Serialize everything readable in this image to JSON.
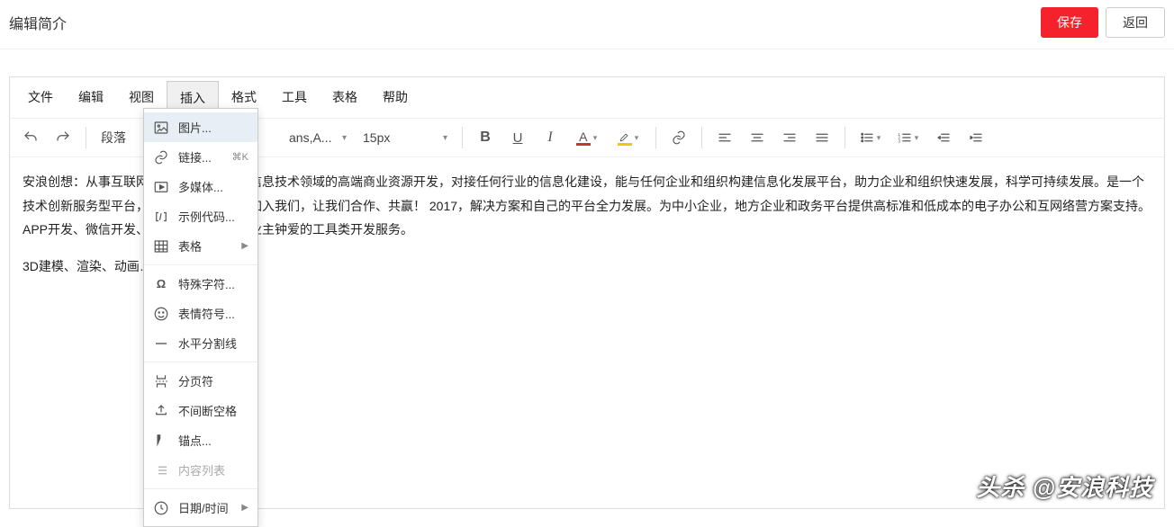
{
  "header": {
    "title": "编辑简介",
    "save": "保存",
    "back": "返回"
  },
  "menubar": {
    "file": "文件",
    "edit": "编辑",
    "view": "视图",
    "insert": "插入",
    "format": "格式",
    "tools": "工具",
    "table": "表格",
    "help": "帮助"
  },
  "toolbar": {
    "block": "段落",
    "font": "ans,A...",
    "size": "15px",
    "text_color": "#c0392b",
    "highlight_color": "#f1c40f"
  },
  "dropdown": {
    "image": "图片...",
    "link": "链接...",
    "link_shortcut": "⌘K",
    "media": "多媒体...",
    "sample": "示例代码...",
    "table": "表格",
    "special_char": "特殊字符...",
    "emoji": "表情符号...",
    "hr": "水平分割线",
    "pagebreak": "分页符",
    "nbsp": "不间断空格",
    "anchor": "锚点...",
    "toc": "内容列表",
    "datetime": "日期/时间"
  },
  "content": {
    "p1": "安浪创想：从事互联网行业多年，专注于信息技术领域的高端商业资源开发，对接任何行业的信息化建设，能与任何企业和组织构建信息化发展平台，助力企业和组织快速发展，科学可持续发展。是一个技术创新服务型平台，欢迎各行业的朋友加入我们，让我们合作、共赢！ 2017，解决方案和自己的平台全力发展。为中小企业，地方企业和政务平台提供高标准和低成本的电子办公和互网络营方案支持。APP开发、微信开发、服务器技术，小企业主钟爱的工具类开发服务。",
    "p2": "3D建模、渲染、动画……"
  },
  "watermark": "头杀 @安浪科技"
}
